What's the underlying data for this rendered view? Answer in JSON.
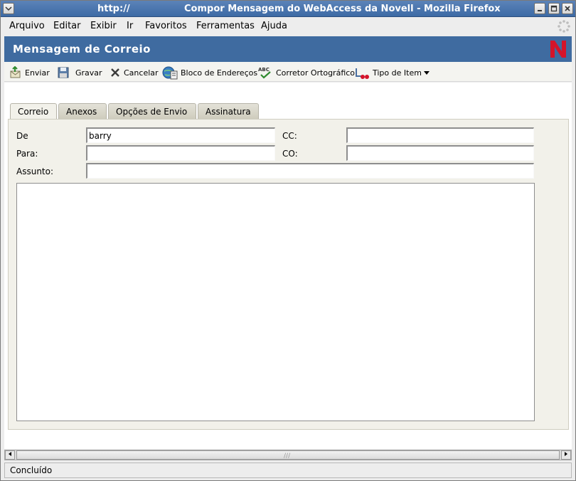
{
  "window": {
    "url": "http://",
    "title": "Compor Mensagem do WebAccess da Novell - Mozilla Firefox"
  },
  "menubar": {
    "items": [
      {
        "label": "Arquivo"
      },
      {
        "label": "Editar"
      },
      {
        "label": "Exibir"
      },
      {
        "label": "Ir"
      },
      {
        "label": "Favoritos"
      },
      {
        "label": "Ferramentas"
      },
      {
        "label": "Ajuda"
      }
    ]
  },
  "webaccess": {
    "header_title": "Mensagem de Correio",
    "logo_letter": "N",
    "brand_color": "#c8102e",
    "header_color": "#3f6ba0"
  },
  "toolbar": {
    "send": "Enviar",
    "save": "Gravar",
    "cancel": "Cancelar",
    "address_book": "Bloco de Endereços",
    "spell_checker": "Corretor Ortográfico",
    "item_type": "Tipo de Item"
  },
  "tabs": [
    {
      "label": "Correio",
      "active": true
    },
    {
      "label": "Anexos"
    },
    {
      "label": "Opções de Envio"
    },
    {
      "label": "Assinatura"
    }
  ],
  "form": {
    "from_label": "De",
    "from_value": "barry",
    "to_label": "Para:",
    "to_value": "",
    "cc_label": "CC:",
    "cc_value": "",
    "bcc_label": "CO:",
    "bcc_value": "",
    "subject_label": "Assunto:",
    "subject_value": "",
    "body_value": ""
  },
  "statusbar": {
    "text": "Concluído"
  }
}
